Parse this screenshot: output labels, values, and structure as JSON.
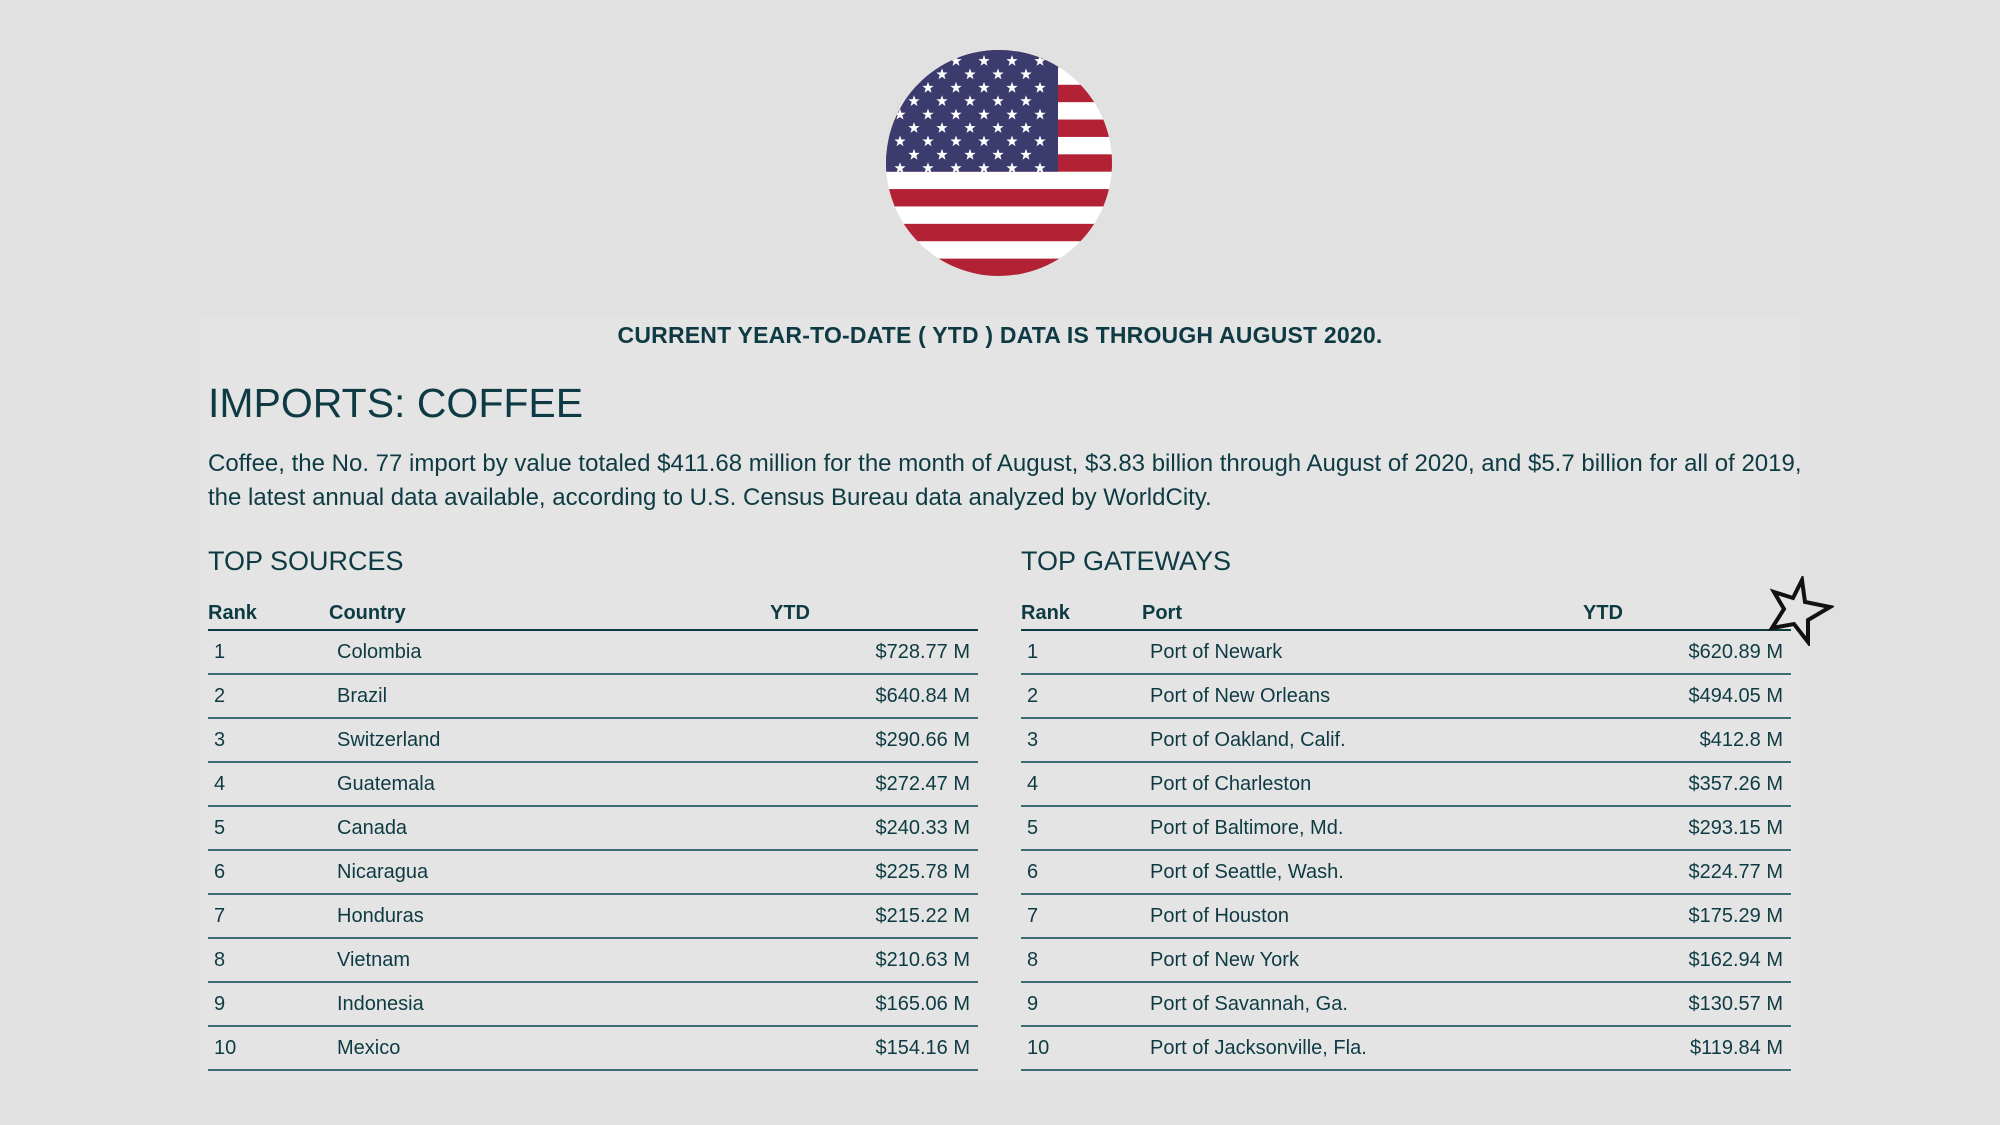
{
  "flag": {
    "icon": "us-flag-icon",
    "colors": {
      "red": "#b22234",
      "blue": "#3c3b6e",
      "white": "#ffffff"
    }
  },
  "header": {
    "ytd_note": "CURRENT YEAR-TO-DATE ( YTD ) DATA IS THROUGH AUGUST 2020."
  },
  "main": {
    "title": "IMPORTS: COFFEE",
    "description": "Coffee, the No. 77 import by value totaled $411.68 million for the month of August, $3.83 billion through August of 2020, and $5.7 billion for all of 2019, the latest annual data available, according to U.S. Census Bureau data analyzed by WorldCity."
  },
  "top_sources": {
    "title": "TOP SOURCES",
    "columns": [
      "Rank",
      "Country",
      "YTD"
    ],
    "rows": [
      [
        "1",
        "Colombia",
        "$728.77 M"
      ],
      [
        "2",
        "Brazil",
        "$640.84 M"
      ],
      [
        "3",
        "Switzerland",
        "$290.66 M"
      ],
      [
        "4",
        "Guatemala",
        "$272.47 M"
      ],
      [
        "5",
        "Canada",
        "$240.33 M"
      ],
      [
        "6",
        "Nicaragua",
        "$225.78 M"
      ],
      [
        "7",
        "Honduras",
        "$215.22 M"
      ],
      [
        "8",
        "Vietnam",
        "$210.63 M"
      ],
      [
        "9",
        "Indonesia",
        "$165.06 M"
      ],
      [
        "10",
        "Mexico",
        "$154.16 M"
      ]
    ]
  },
  "top_gateways": {
    "title": "TOP GATEWAYS",
    "columns": [
      "Rank",
      "Port",
      "YTD"
    ],
    "rows": [
      [
        "1",
        "Port of Newark",
        "$620.89 M"
      ],
      [
        "2",
        "Port of New Orleans",
        "$494.05 M"
      ],
      [
        "3",
        "Port of Oakland, Calif.",
        "$412.8 M"
      ],
      [
        "4",
        "Port of Charleston",
        "$357.26 M"
      ],
      [
        "5",
        "Port of Baltimore, Md.",
        "$293.15 M"
      ],
      [
        "6",
        "Port of Seattle, Wash.",
        "$224.77 M"
      ],
      [
        "7",
        "Port of Houston",
        "$175.29 M"
      ],
      [
        "8",
        "Port of New York",
        "$162.94 M"
      ],
      [
        "9",
        "Port of Savannah, Ga.",
        "$130.57 M"
      ],
      [
        "10",
        "Port of Jacksonville, Fla.",
        "$119.84 M"
      ]
    ]
  },
  "cursor": {
    "icon": "star-outline-icon"
  }
}
